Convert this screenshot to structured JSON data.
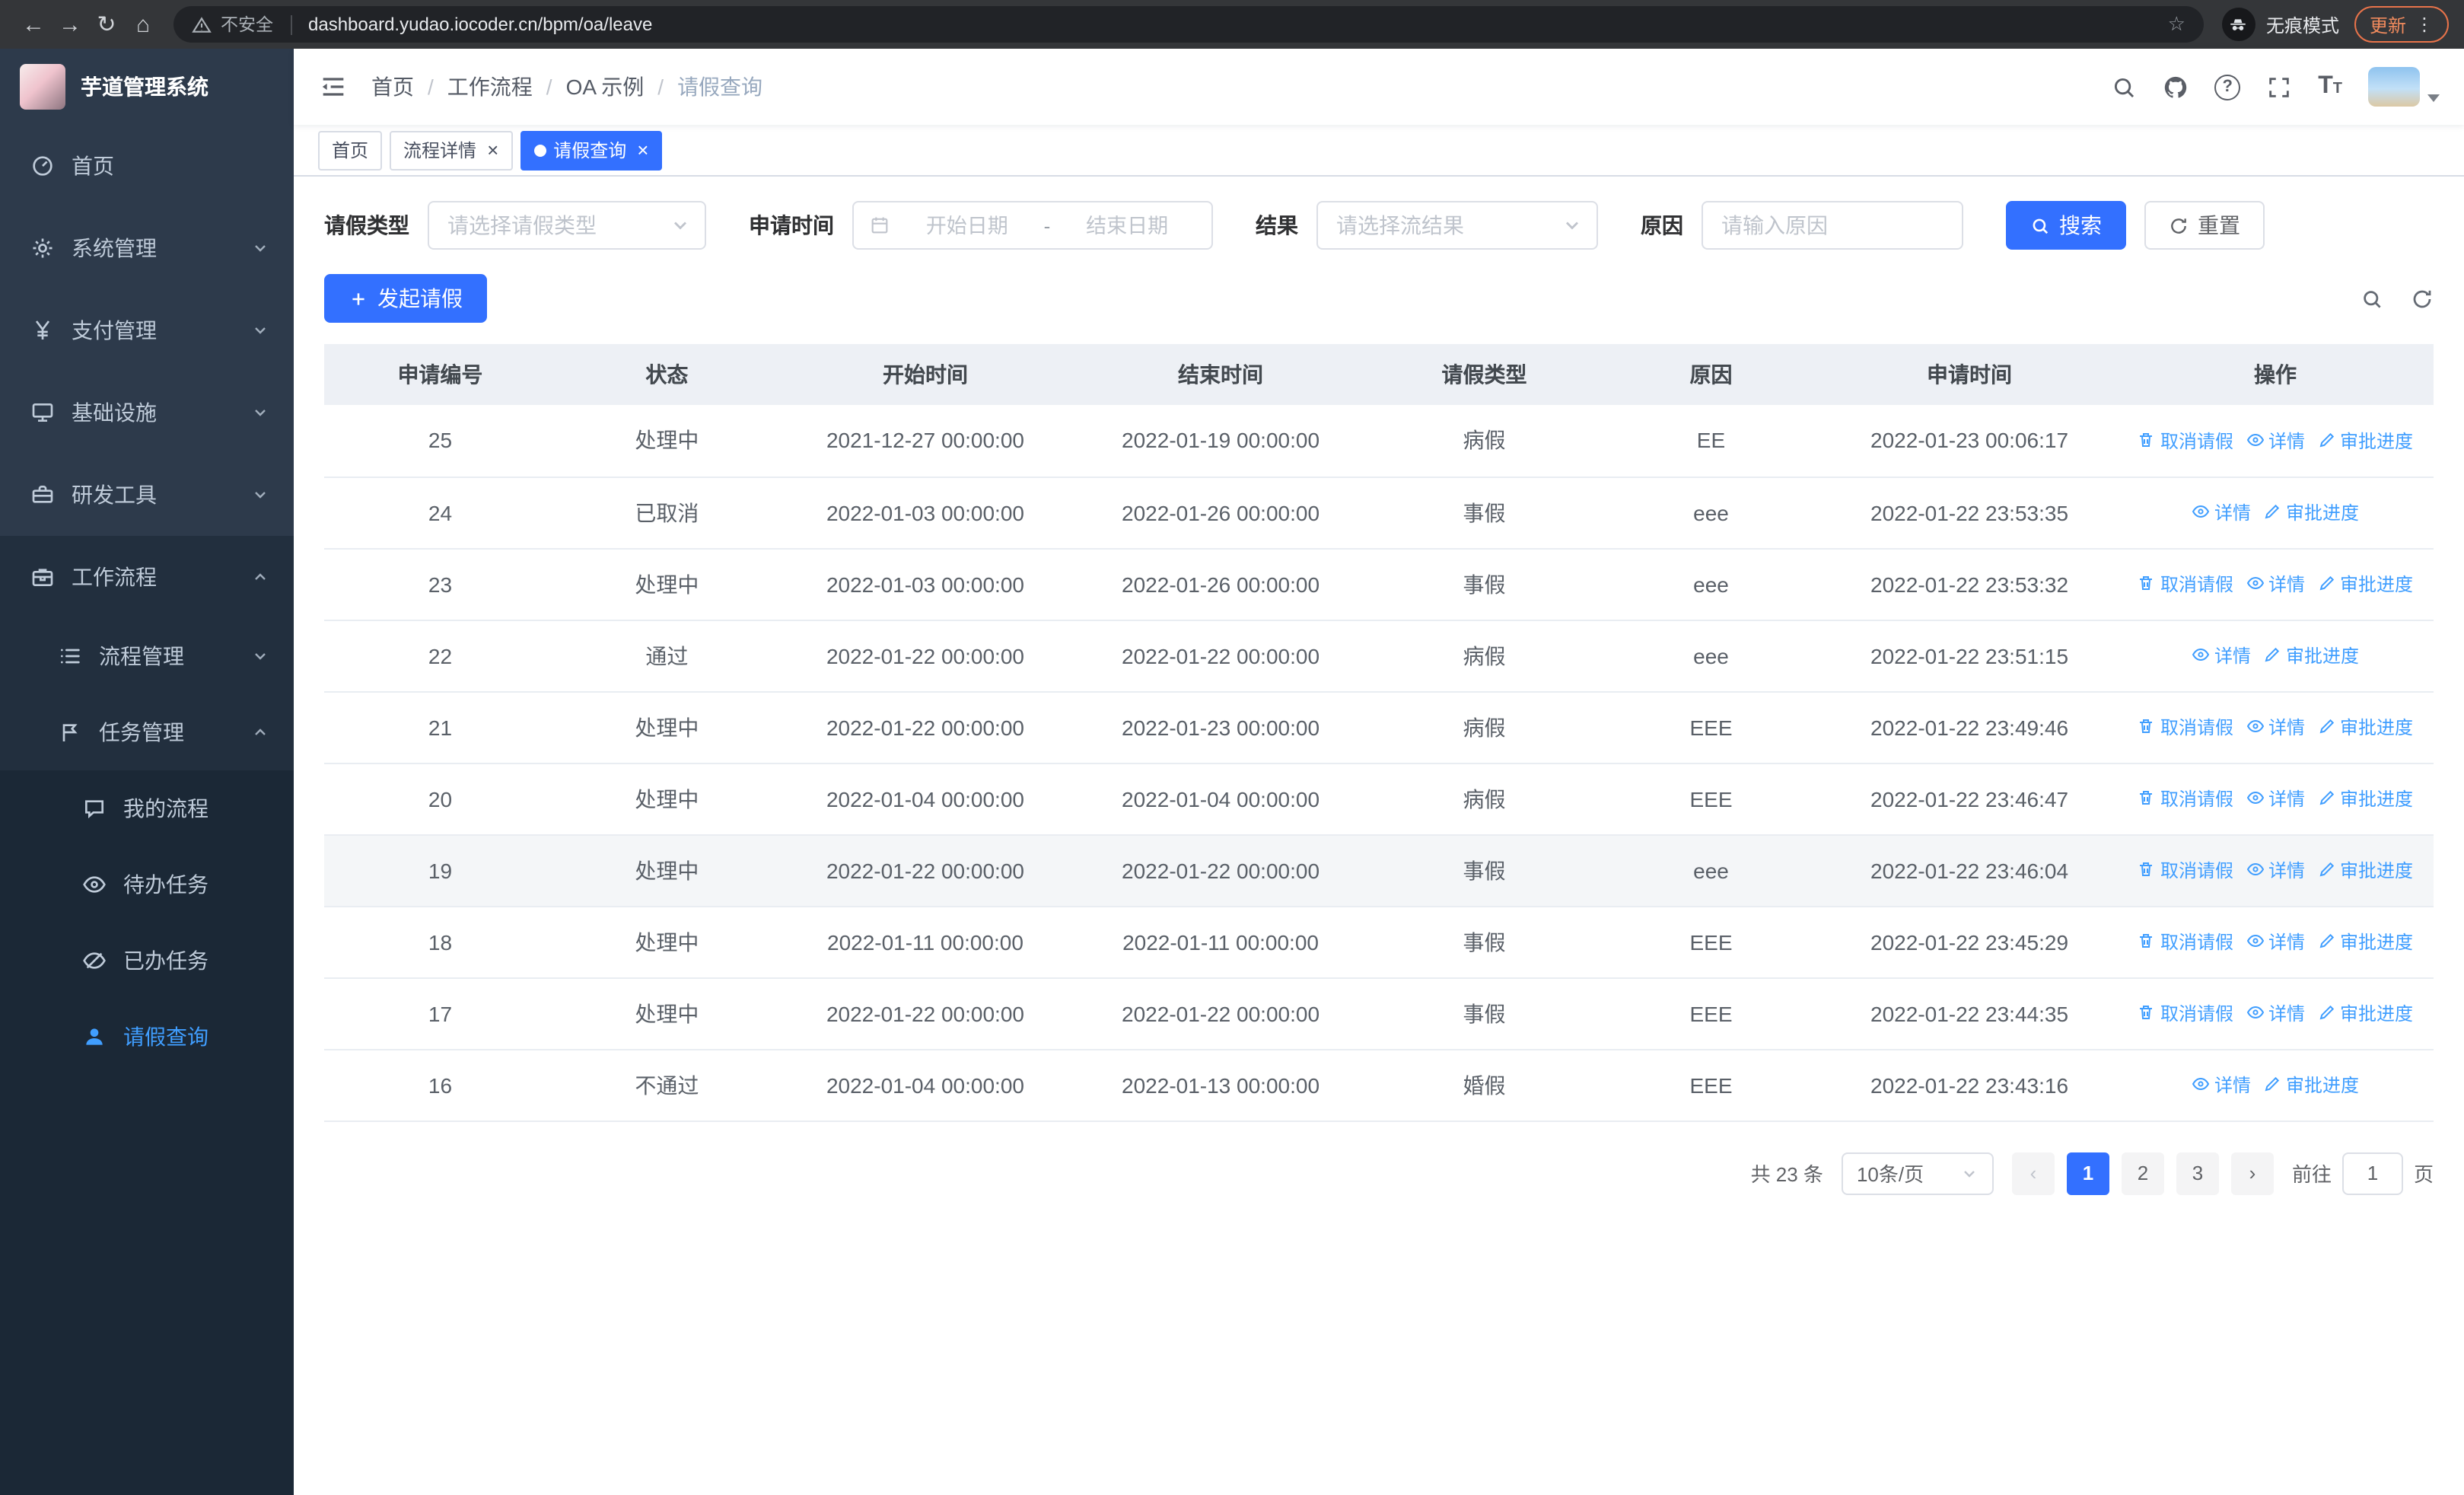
{
  "browser": {
    "security_warning": "不安全",
    "url": "dashboard.yudao.iocoder.cn/bpm/oa/leave",
    "incognito_label": "无痕模式",
    "update_button": "更新"
  },
  "icons": {
    "back": "←",
    "forward": "→",
    "reload": "↻",
    "home": "⌂",
    "star": "☆",
    "menu_dots": "⋮",
    "prev": "‹",
    "next": "›",
    "close": "×",
    "help": "?",
    "font_t": "T"
  },
  "sidebar": {
    "app_title": "芋道管理系统",
    "home": "首页",
    "system": "系统管理",
    "payment": "支付管理",
    "infra": "基础设施",
    "devtools": "研发工具",
    "workflow": "工作流程",
    "process_mgmt": "流程管理",
    "task_mgmt": "任务管理",
    "my_process": "我的流程",
    "todo_tasks": "待办任务",
    "done_tasks": "已办任务",
    "leave_query": "请假查询"
  },
  "header": {
    "breadcrumb": [
      "首页",
      "工作流程",
      "OA 示例",
      "请假查询"
    ]
  },
  "tags": [
    {
      "label": "首页",
      "closable": false,
      "active": false
    },
    {
      "label": "流程详情",
      "closable": true,
      "active": false
    },
    {
      "label": "请假查询",
      "closable": true,
      "active": true
    }
  ],
  "filters": {
    "leave_type_label": "请假类型",
    "leave_type_placeholder": "请选择请假类型",
    "apply_time_label": "申请时间",
    "date_start_placeholder": "开始日期",
    "date_separator": "-",
    "date_end_placeholder": "结束日期",
    "result_label": "结果",
    "result_placeholder": "请选择流结果",
    "reason_label": "原因",
    "reason_placeholder": "请输入原因",
    "search_button": "搜索",
    "reset_button": "重置"
  },
  "toolbar": {
    "create_button": "发起请假"
  },
  "table": {
    "columns": [
      "申请编号",
      "状态",
      "开始时间",
      "结束时间",
      "请假类型",
      "原因",
      "申请时间",
      "操作"
    ],
    "action_labels": {
      "cancel": "取消请假",
      "detail": "详情",
      "progress": "审批进度"
    },
    "action_icons": {
      "cancel": "delete-icon",
      "detail": "view-icon",
      "progress": "edit-icon"
    },
    "rows": [
      {
        "id": "25",
        "status": "处理中",
        "start": "2021-12-27 00:00:00",
        "end": "2022-01-19 00:00:00",
        "type": "病假",
        "reason": "EE",
        "applied": "2022-01-23 00:06:17",
        "actions": [
          "cancel",
          "detail",
          "progress"
        ],
        "hover": false
      },
      {
        "id": "24",
        "status": "已取消",
        "start": "2022-01-03 00:00:00",
        "end": "2022-01-26 00:00:00",
        "type": "事假",
        "reason": "eee",
        "applied": "2022-01-22 23:53:35",
        "actions": [
          "detail",
          "progress"
        ],
        "hover": false
      },
      {
        "id": "23",
        "status": "处理中",
        "start": "2022-01-03 00:00:00",
        "end": "2022-01-26 00:00:00",
        "type": "事假",
        "reason": "eee",
        "applied": "2022-01-22 23:53:32",
        "actions": [
          "cancel",
          "detail",
          "progress"
        ],
        "hover": false
      },
      {
        "id": "22",
        "status": "通过",
        "start": "2022-01-22 00:00:00",
        "end": "2022-01-22 00:00:00",
        "type": "病假",
        "reason": "eee",
        "applied": "2022-01-22 23:51:15",
        "actions": [
          "detail",
          "progress"
        ],
        "hover": false
      },
      {
        "id": "21",
        "status": "处理中",
        "start": "2022-01-22 00:00:00",
        "end": "2022-01-23 00:00:00",
        "type": "病假",
        "reason": "EEE",
        "applied": "2022-01-22 23:49:46",
        "actions": [
          "cancel",
          "detail",
          "progress"
        ],
        "hover": false
      },
      {
        "id": "20",
        "status": "处理中",
        "start": "2022-01-04 00:00:00",
        "end": "2022-01-04 00:00:00",
        "type": "病假",
        "reason": "EEE",
        "applied": "2022-01-22 23:46:47",
        "actions": [
          "cancel",
          "detail",
          "progress"
        ],
        "hover": false
      },
      {
        "id": "19",
        "status": "处理中",
        "start": "2022-01-22 00:00:00",
        "end": "2022-01-22 00:00:00",
        "type": "事假",
        "reason": "eee",
        "applied": "2022-01-22 23:46:04",
        "actions": [
          "cancel",
          "detail",
          "progress"
        ],
        "hover": true
      },
      {
        "id": "18",
        "status": "处理中",
        "start": "2022-01-11 00:00:00",
        "end": "2022-01-11 00:00:00",
        "type": "事假",
        "reason": "EEE",
        "applied": "2022-01-22 23:45:29",
        "actions": [
          "cancel",
          "detail",
          "progress"
        ],
        "hover": false
      },
      {
        "id": "17",
        "status": "处理中",
        "start": "2022-01-22 00:00:00",
        "end": "2022-01-22 00:00:00",
        "type": "事假",
        "reason": "EEE",
        "applied": "2022-01-22 23:44:35",
        "actions": [
          "cancel",
          "detail",
          "progress"
        ],
        "hover": false
      },
      {
        "id": "16",
        "status": "不通过",
        "start": "2022-01-04 00:00:00",
        "end": "2022-01-13 00:00:00",
        "type": "婚假",
        "reason": "EEE",
        "applied": "2022-01-22 23:43:16",
        "actions": [
          "detail",
          "progress"
        ],
        "hover": false
      }
    ]
  },
  "pagination": {
    "total_text": "共 23 条",
    "page_size": "10条/页",
    "pages": [
      "1",
      "2",
      "3"
    ],
    "active_page": "1",
    "goto_label": "前往",
    "goto_value": "1",
    "goto_suffix": "页"
  },
  "colors": {
    "accent": "#3370ff",
    "link": "#409eff",
    "sidebar_bg": "#2d3a4b"
  }
}
